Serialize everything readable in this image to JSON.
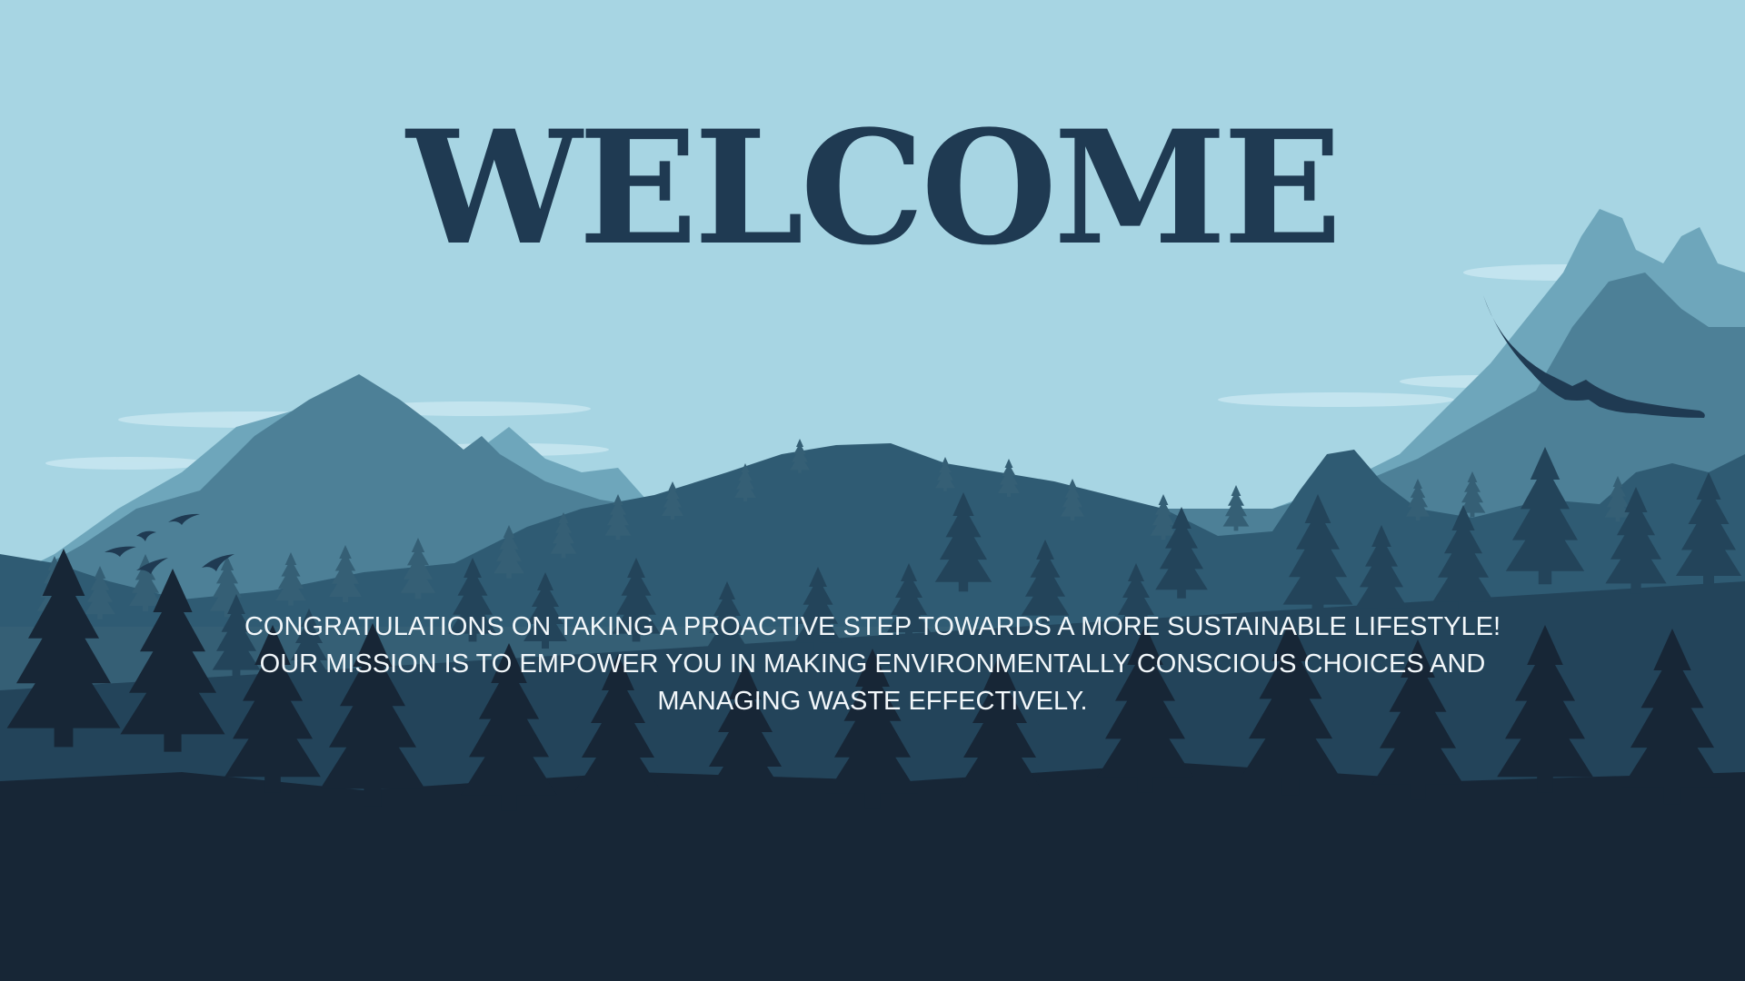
{
  "slide": {
    "title": "WELCOME",
    "message_lines": [
      "CONGRATULATIONS ON TAKING A PROACTIVE STEP TOWARDS A MORE SUSTAINABLE LIFESTYLE!",
      "OUR MISSION IS TO EMPOWER YOU IN MAKING ENVIRONMENTALLY CONSCIOUS CHOICES AND",
      "MANAGING WASTE EFFECTIVELY."
    ]
  },
  "colors": {
    "sky": "#a7d5e3",
    "title": "#1f3a52",
    "text": "#f2f7fa",
    "mountain_far": "#6ea6bb",
    "mountain_mid": "#4d8097",
    "hills": "#2f5b73",
    "forest_back": "#355f75",
    "forest_mid": "#23445a",
    "forest_front": "#172636"
  }
}
